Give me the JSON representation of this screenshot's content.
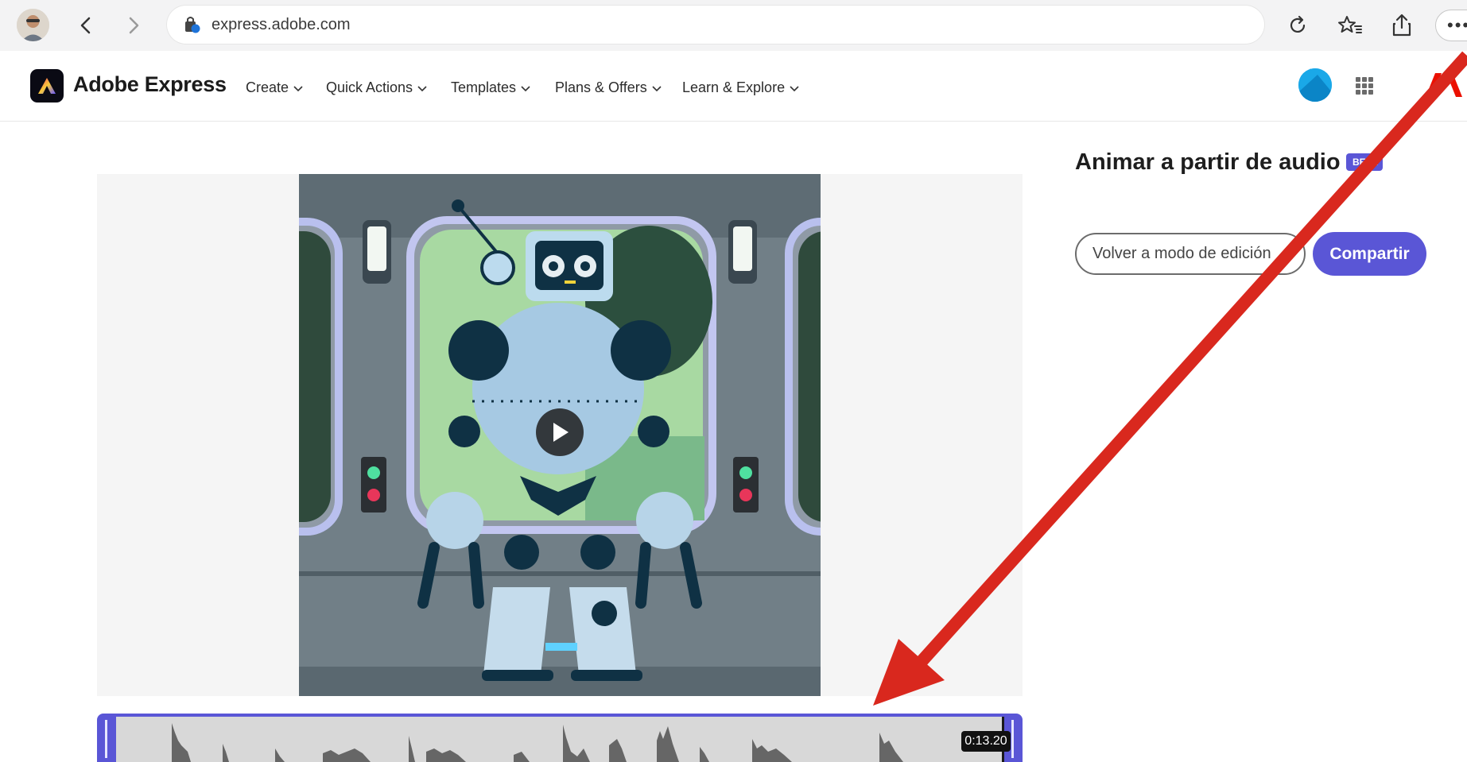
{
  "browser": {
    "url": "express.adobe.com"
  },
  "header": {
    "brand": "Adobe Express",
    "menu": [
      {
        "label": "Create"
      },
      {
        "label": "Quick Actions"
      },
      {
        "label": "Templates"
      },
      {
        "label": "Plans & Offers"
      },
      {
        "label": "Learn & Explore"
      }
    ]
  },
  "panel": {
    "title": "Animar a partir de audio",
    "badge": "BETA",
    "back_to_edit": "Volver a modo de edición",
    "share": "Compartir"
  },
  "timeline": {
    "time": "0:13.20"
  },
  "colors": {
    "accent": "#5a56d6",
    "arrow": "#d9281e"
  },
  "icons": [
    "profile-avatar",
    "back-arrow-icon",
    "forward-arrow-icon",
    "site-lock-icon",
    "reload-icon",
    "favorites-icon",
    "share-icon",
    "more-icon",
    "apps-grid-icon",
    "adobe-logo-icon",
    "play-icon"
  ]
}
